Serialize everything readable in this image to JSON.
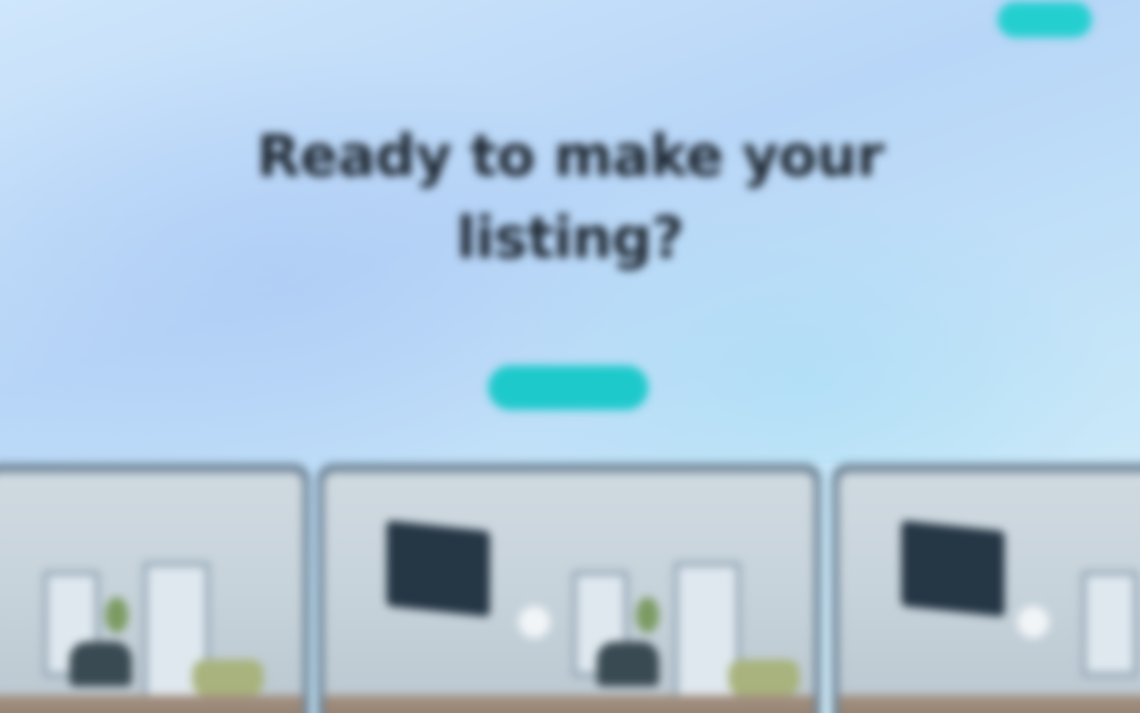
{
  "header": {
    "logo_text": "",
    "nav_links": [
      "",
      ""
    ],
    "cta_label": ""
  },
  "hero": {
    "title": "Ready to make your listing?",
    "subtitle": "",
    "cta_label": ""
  },
  "gallery": {
    "cards": [
      {
        "image": "room-photo"
      },
      {
        "image": "room-photo"
      },
      {
        "image": "room-photo"
      }
    ]
  },
  "colors": {
    "accent": "#24cfd0",
    "background": "#c6e0f7",
    "title": "#1d2630"
  }
}
